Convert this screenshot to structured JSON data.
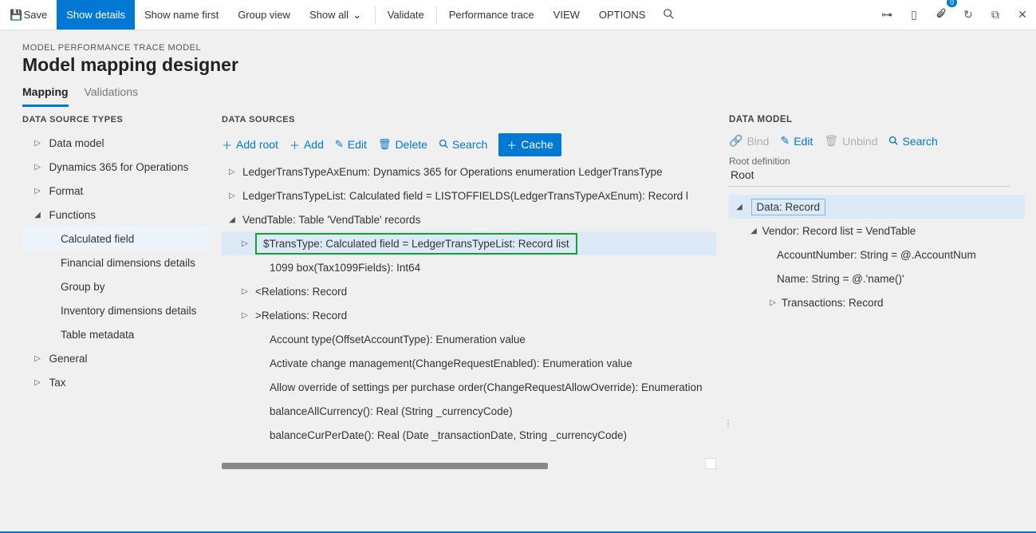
{
  "toolbar": {
    "save": "Save",
    "show_details": "Show details",
    "show_name_first": "Show name first",
    "group_view": "Group view",
    "show_all": "Show all",
    "validate": "Validate",
    "performance_trace": "Performance trace",
    "view": "VIEW",
    "options": "OPTIONS",
    "badge_count": "0"
  },
  "header": {
    "breadcrumb": "MODEL PERFORMANCE TRACE MODEL",
    "title": "Model mapping designer"
  },
  "tabs": {
    "mapping": "Mapping",
    "validations": "Validations"
  },
  "col1": {
    "heading": "DATA SOURCE TYPES",
    "items": {
      "data_model": "Data model",
      "dynamics": "Dynamics 365 for Operations",
      "format": "Format",
      "functions": "Functions",
      "calculated_field": "Calculated field",
      "fin_dims": "Financial dimensions details",
      "group_by": "Group by",
      "inv_dims": "Inventory dimensions details",
      "table_meta": "Table metadata",
      "general": "General",
      "tax": "Tax"
    }
  },
  "col2": {
    "heading": "DATA SOURCES",
    "actions": {
      "add_root": "Add root",
      "add": "Add",
      "edit": "Edit",
      "delete": "Delete",
      "search": "Search",
      "cache": "Cache"
    },
    "rows": {
      "r0": "LedgerTransTypeAxEnum: Dynamics 365 for Operations enumeration LedgerTransType",
      "r1": "LedgerTransTypeList: Calculated field = LISTOFFIELDS(LedgerTransTypeAxEnum): Record l",
      "r2": "VendTable: Table 'VendTable' records",
      "r3": "$TransType: Calculated field = LedgerTransTypeList: Record list",
      "r4": "1099 box(Tax1099Fields): Int64",
      "r5": "<Relations: Record",
      "r6": ">Relations: Record",
      "r7": "Account type(OffsetAccountType): Enumeration value",
      "r8": "Activate change management(ChangeRequestEnabled): Enumeration value",
      "r9": "Allow override of settings per purchase order(ChangeRequestAllowOverride): Enumeration",
      "r10": "balanceAllCurrency(): Real (String _currencyCode)",
      "r11": "balanceCurPerDate(): Real (Date _transactionDate, String _currencyCode)"
    }
  },
  "col3": {
    "heading": "DATA MODEL",
    "actions": {
      "bind": "Bind",
      "edit": "Edit",
      "unbind": "Unbind",
      "search": "Search"
    },
    "root_def_label": "Root definition",
    "root_def_value": "Root",
    "rows": {
      "r0": "Data: Record",
      "r1": "Vendor: Record list = VendTable",
      "r2": "AccountNumber: String = @.AccountNum",
      "r3": "Name: String = @.'name()'",
      "r4": "Transactions: Record"
    }
  }
}
